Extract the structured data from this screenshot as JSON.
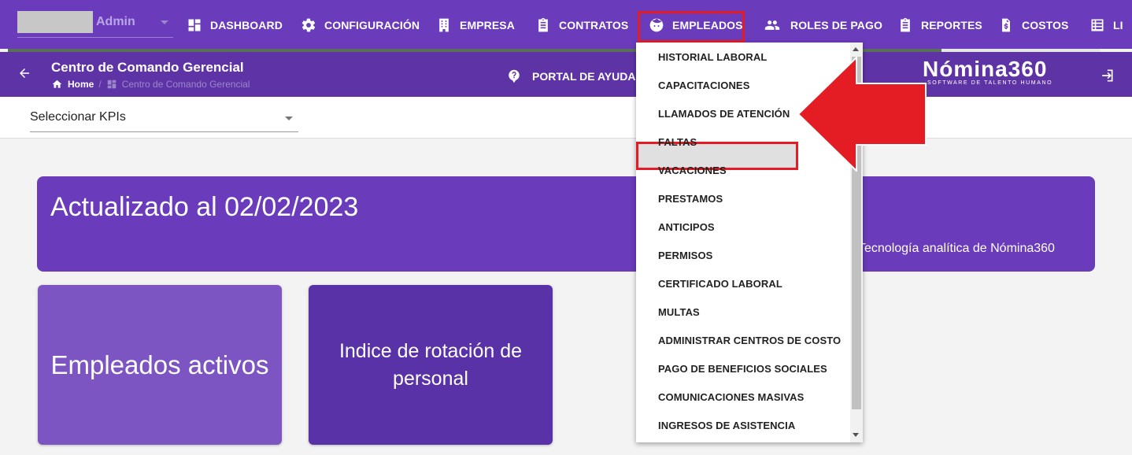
{
  "user": {
    "name": "Admin"
  },
  "nav": [
    {
      "label": "DASHBOARD",
      "icon": "dashboard-icon"
    },
    {
      "label": "CONFIGURACIÓN",
      "icon": "gear-icon"
    },
    {
      "label": "EMPRESA",
      "icon": "building-icon"
    },
    {
      "label": "CONTRATOS",
      "icon": "clipboard-icon"
    },
    {
      "label": "EMPLEADOS",
      "icon": "face-icon"
    },
    {
      "label": "ROLES DE PAGO",
      "icon": "people-icon"
    },
    {
      "label": "REPORTES",
      "icon": "clipboard-icon"
    },
    {
      "label": "COSTOS",
      "icon": "invoice-icon"
    },
    {
      "label": "LI",
      "icon": "list-icon"
    }
  ],
  "header": {
    "title": "Centro de Comando Gerencial",
    "breadcrumb_home": "Home",
    "breadcrumb_sep": "/",
    "breadcrumb_current": "Centro de Comando Gerencial",
    "help_label": "PORTAL DE AYUDA",
    "logo_text": "Nómina360",
    "logo_tagline": "SOFTWARE DE TALENTO HUMANO"
  },
  "kpi_select": {
    "value": "Seleccionar KPIs"
  },
  "banner": {
    "title": "Actualizado al 02/02/2023",
    "subtitle": "Tecnología analítica de Nómina360"
  },
  "cards": [
    {
      "label": "Empleados activos"
    },
    {
      "label": "Indice de rotación de personal"
    }
  ],
  "dropdown": {
    "items": [
      "HISTORIAL LABORAL",
      "CAPACITACIONES",
      "LLAMADOS DE ATENCIÓN",
      "FALTAS",
      "VACACIONES",
      "PRESTAMOS",
      "ANTICIPOS",
      "PERMISOS",
      "CERTIFICADO LABORAL",
      "MULTAS",
      "ADMINISTRAR CENTROS DE COSTO",
      "PAGO DE BENEFICIOS SOCIALES",
      "COMUNICACIONES MASIVAS",
      "INGRESOS DE ASISTENCIA"
    ],
    "highlighted_index": 2
  },
  "colors": {
    "primary": "#6a3bbb",
    "header": "#5e33a6",
    "highlight": "#e41d24"
  }
}
